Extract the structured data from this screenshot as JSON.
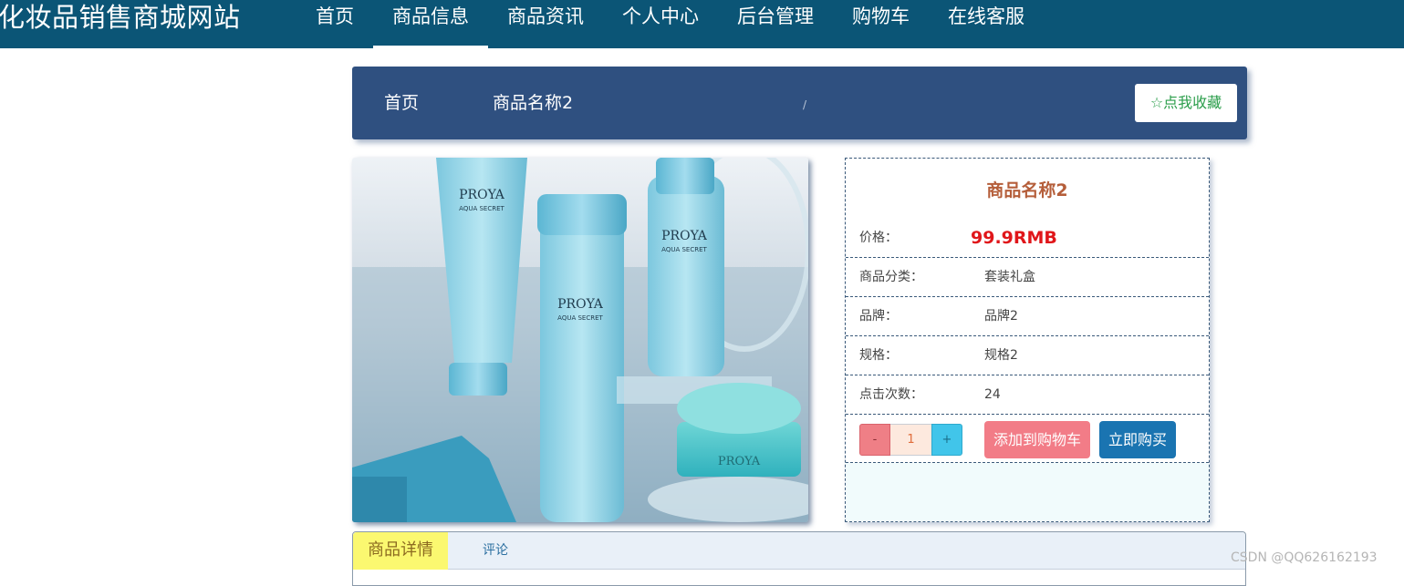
{
  "site": {
    "title": "化妆品销售商城网站"
  },
  "nav": {
    "items": [
      {
        "label": "首页",
        "active": false
      },
      {
        "label": "商品信息",
        "active": true
      },
      {
        "label": "商品资讯",
        "active": false
      },
      {
        "label": "个人中心",
        "active": false
      },
      {
        "label": "后台管理",
        "active": false
      },
      {
        "label": "购物车",
        "active": false
      },
      {
        "label": "在线客服",
        "active": false
      }
    ]
  },
  "breadcrumb": {
    "home": "首页",
    "separator": "/",
    "current": "商品名称2"
  },
  "favorite": {
    "label": "点我收藏",
    "icon": "star-outline-icon",
    "icon_glyph": "☆"
  },
  "product": {
    "name": "商品名称2",
    "image_brand_text": "PROYA",
    "image_sub_text": "AQUA SECRET",
    "price_label": "价格：",
    "price_value": "99.9RMB",
    "category_label": "商品分类：",
    "category_value": "套装礼盒",
    "brand_label": "品牌：",
    "brand_value": "品牌2",
    "spec_label": "规格：",
    "spec_value": "规格2",
    "clicks_label": "点击次数：",
    "clicks_value": "24"
  },
  "quantity": {
    "minus": "-",
    "value": "1",
    "plus": "+"
  },
  "actions": {
    "add_to_cart": "添加到购物车",
    "buy_now": "立即购买"
  },
  "tabs": [
    {
      "label": "商品详情",
      "active": true
    },
    {
      "label": "评论",
      "active": false
    }
  ],
  "watermark": "CSDN @QQ626162193",
  "colors": {
    "topbar": "#0b5576",
    "breadcrumb_bg": "#2f5080",
    "price": "#e0161a",
    "product_name": "#b55e3a",
    "cart_button": "#f27c87",
    "buy_button": "#1a74b1",
    "active_tab": "#fbf870"
  }
}
